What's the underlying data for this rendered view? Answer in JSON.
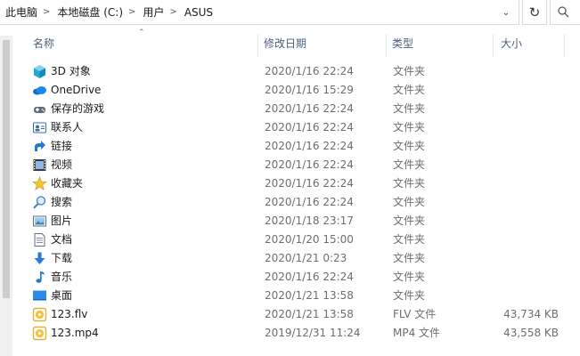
{
  "breadcrumb": [
    "此电脑",
    "本地磁盘 (C:)",
    "用户",
    "ASUS"
  ],
  "columns": {
    "name": "名称",
    "date": "修改日期",
    "type": "类型",
    "size": "大小"
  },
  "files": [
    {
      "name": "3D 对象",
      "date": "2020/1/16 22:24",
      "type": "文件夹",
      "size": "",
      "icon": "3d-objects-icon"
    },
    {
      "name": "OneDrive",
      "date": "2020/1/16 15:29",
      "type": "文件夹",
      "size": "",
      "icon": "onedrive-icon"
    },
    {
      "name": "保存的游戏",
      "date": "2020/1/16 22:24",
      "type": "文件夹",
      "size": "",
      "icon": "saved-games-icon"
    },
    {
      "name": "联系人",
      "date": "2020/1/16 22:24",
      "type": "文件夹",
      "size": "",
      "icon": "contacts-icon"
    },
    {
      "name": "链接",
      "date": "2020/1/16 22:24",
      "type": "文件夹",
      "size": "",
      "icon": "links-icon"
    },
    {
      "name": "视频",
      "date": "2020/1/16 22:24",
      "type": "文件夹",
      "size": "",
      "icon": "videos-icon"
    },
    {
      "name": "收藏夹",
      "date": "2020/1/16 22:24",
      "type": "文件夹",
      "size": "",
      "icon": "favorites-icon"
    },
    {
      "name": "搜索",
      "date": "2020/1/16 22:24",
      "type": "文件夹",
      "size": "",
      "icon": "searches-icon"
    },
    {
      "name": "图片",
      "date": "2020/1/18 23:17",
      "type": "文件夹",
      "size": "",
      "icon": "pictures-icon"
    },
    {
      "name": "文档",
      "date": "2020/1/20 15:00",
      "type": "文件夹",
      "size": "",
      "icon": "documents-icon"
    },
    {
      "name": "下载",
      "date": "2020/1/21 0:23",
      "type": "文件夹",
      "size": "",
      "icon": "downloads-icon"
    },
    {
      "name": "音乐",
      "date": "2020/1/16 22:24",
      "type": "文件夹",
      "size": "",
      "icon": "music-icon"
    },
    {
      "name": "桌面",
      "date": "2020/1/21 13:58",
      "type": "文件夹",
      "size": "",
      "icon": "desktop-icon"
    },
    {
      "name": "123.flv",
      "date": "2020/1/21 13:58",
      "type": "FLV 文件",
      "size": "43,734 KB",
      "icon": "video-file-icon"
    },
    {
      "name": "123.mp4",
      "date": "2019/12/31 11:24",
      "type": "MP4 文件",
      "size": "43,558 KB",
      "icon": "video-file-icon"
    }
  ]
}
